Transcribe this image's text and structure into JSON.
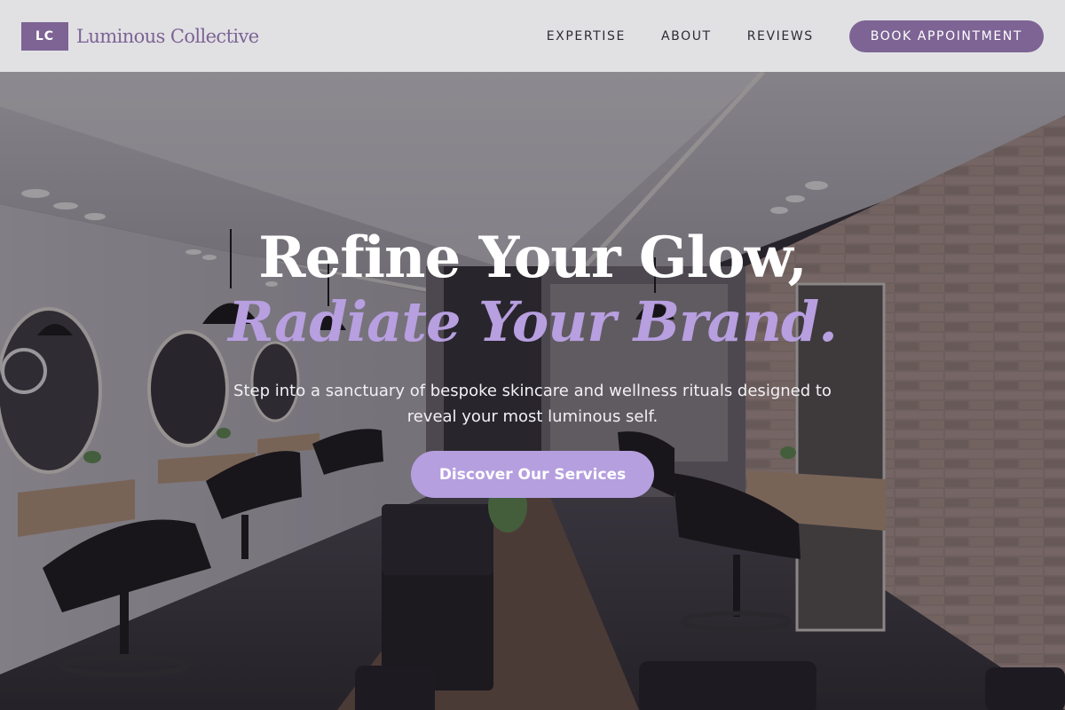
{
  "brand": {
    "mark": "LC",
    "name": "Luminous Collective"
  },
  "nav": {
    "items": [
      {
        "label": "EXPERTISE"
      },
      {
        "label": "ABOUT"
      },
      {
        "label": "REVIEWS"
      }
    ],
    "cta_label": "BOOK APPOINTMENT"
  },
  "hero": {
    "headline_line1": "Refine Your Glow,",
    "headline_line2": "Radiate Your Brand.",
    "tagline": "Step into a sanctuary of bespoke skincare and wellness rituals designed to reveal your most luminous self.",
    "cta_label": "Discover Our Services",
    "background_image": "salon-interior-photo"
  },
  "colors": {
    "brand_purple": "#7d6494",
    "accent_lavender": "#b59fdf",
    "header_bg": "#f0f0f2"
  }
}
